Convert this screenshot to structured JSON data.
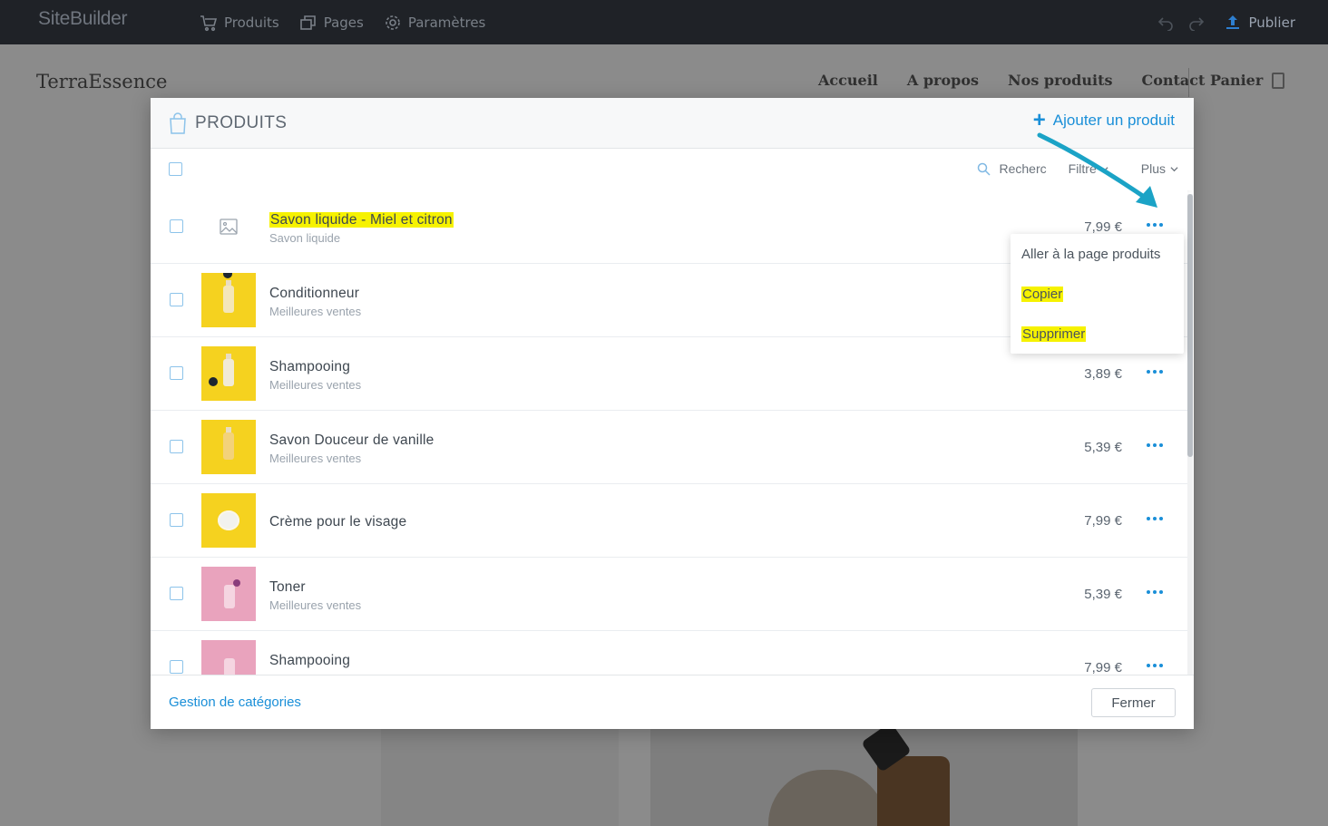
{
  "app": {
    "brand": "SiteBuilder",
    "nav": [
      {
        "label": "Produits",
        "icon": "cart-icon"
      },
      {
        "label": "Pages",
        "icon": "pages-icon"
      },
      {
        "label": "Paramètres",
        "icon": "gear-icon"
      }
    ],
    "publish_label": "Publier"
  },
  "site": {
    "logo": "TerraEssence",
    "nav": [
      "Accueil",
      "A propos",
      "Nos produits",
      "Contact"
    ],
    "cart_label": "Panier"
  },
  "modal": {
    "title": "PRODUITS",
    "add_label": "Ajouter un produit",
    "toolbar": {
      "search_placeholder": "Recherche",
      "search_visible": "Recherc",
      "filter_label": "Filtre",
      "more_label": "Plus"
    },
    "products": [
      {
        "name": "Savon liquide - Miel et citron",
        "category": "Savon liquide",
        "price": "7,99 €",
        "thumb": "placeholder"
      },
      {
        "name": "Conditionneur",
        "category": "Meilleures ventes",
        "price": "",
        "thumb": "yellow"
      },
      {
        "name": "Shampooing",
        "category": "Meilleures ventes",
        "price": "3,89 €",
        "thumb": "yellow"
      },
      {
        "name": "Savon Douceur de vanille",
        "category": "Meilleures ventes",
        "price": "5,39 €",
        "thumb": "yellow"
      },
      {
        "name": "Crème pour le visage",
        "category": "",
        "price": "7,99 €",
        "thumb": "yellow"
      },
      {
        "name": "Toner",
        "category": "Meilleures ventes",
        "price": "5,39 €",
        "thumb": "pink"
      },
      {
        "name": "Shampooing",
        "category": "",
        "price": "7,99 €",
        "thumb": "pink"
      }
    ],
    "menu": [
      "Aller à la page produits",
      "Copier",
      "Supprimer"
    ],
    "footer": {
      "categories_link": "Gestion de catégories",
      "close_label": "Fermer"
    }
  },
  "colors": {
    "accent": "#1a8fd8",
    "highlight": "#f6f200",
    "annotation_arrow": "#1ba3c6"
  }
}
